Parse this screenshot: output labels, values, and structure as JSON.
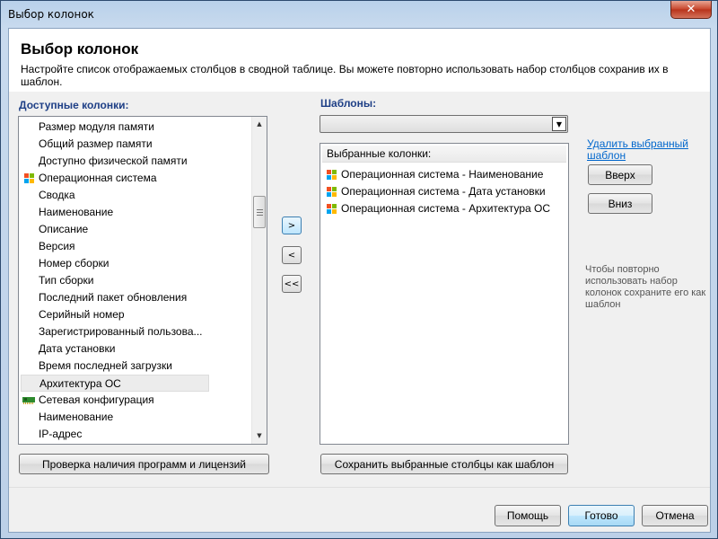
{
  "window": {
    "title": "Выбор колонок",
    "close_label": "✕"
  },
  "header": {
    "title": "Выбор колонок",
    "subtitle": "Настройте список отображаемых столбцов в сводной таблице. Вы можете повторно использовать набор столбцов сохранив их в шаблон."
  },
  "available": {
    "label": "Доступные колонки:",
    "items": [
      {
        "label": "Размер модуля памяти",
        "icon": "none"
      },
      {
        "label": "Общий размер памяти",
        "icon": "none"
      },
      {
        "label": "Доступно физической памяти",
        "icon": "none"
      },
      {
        "label": "Операционная система",
        "icon": "windows-logo-icon"
      },
      {
        "label": "Сводка",
        "icon": "none"
      },
      {
        "label": "Наименование",
        "icon": "none"
      },
      {
        "label": "Описание",
        "icon": "none"
      },
      {
        "label": "Версия",
        "icon": "none"
      },
      {
        "label": "Номер сборки",
        "icon": "none"
      },
      {
        "label": "Тип сборки",
        "icon": "none"
      },
      {
        "label": "Последний пакет обновления",
        "icon": "none"
      },
      {
        "label": "Серийный номер",
        "icon": "none"
      },
      {
        "label": "Зарегистрированный пользова...",
        "icon": "none"
      },
      {
        "label": "Дата установки",
        "icon": "none"
      },
      {
        "label": "Время последней загрузки",
        "icon": "none"
      },
      {
        "label": "Архитектура ОС",
        "icon": "none",
        "selected": true
      },
      {
        "label": "Сетевая конфигурация",
        "icon": "network-card-icon"
      },
      {
        "label": "Наименование",
        "icon": "none"
      },
      {
        "label": "IP-адрес",
        "icon": "none"
      }
    ]
  },
  "transfer": {
    "add": ">",
    "remove": "<",
    "remove_all": "<<"
  },
  "templates": {
    "label": "Шаблоны:",
    "selected": ""
  },
  "selected_columns": {
    "header": "Выбранные колонки:",
    "items": [
      "Операционная система - Наименование",
      "Операционная система - Дата установки",
      "Операционная система - Архитектура ОС"
    ]
  },
  "side": {
    "delete_template_link": "Удалить выбранный шаблон",
    "up_label": "Вверх",
    "down_label": "Вниз",
    "hint": "Чтобы повторно использовать набор колонок сохраните его как шаблон"
  },
  "buttons": {
    "check_programs": "Проверка наличия программ и лицензий",
    "save_template": "Сохранить выбранные столбцы как шаблон",
    "help": "Помощь",
    "ok": "Готово",
    "cancel": "Отмена"
  },
  "colors": {
    "section_label": "#1e3f86",
    "link": "#0066cc",
    "accent_blue": "#3c7fb1"
  }
}
